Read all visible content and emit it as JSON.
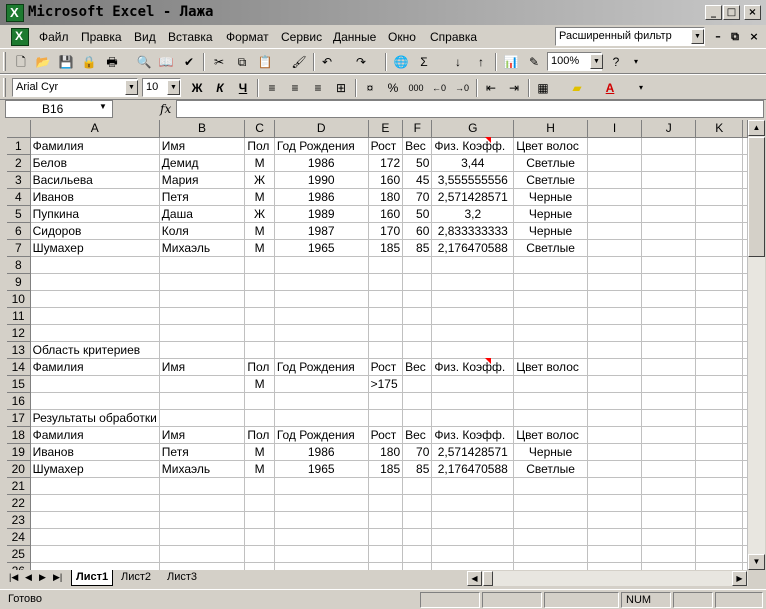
{
  "window": {
    "title": "Microsoft Excel - Лажа",
    "app_icon_letter": "X"
  },
  "menu": [
    {
      "label": "Файл"
    },
    {
      "label": "Правка"
    },
    {
      "label": "Вид"
    },
    {
      "label": "Вставка"
    },
    {
      "label": "Формат"
    },
    {
      "label": "Сервис"
    },
    {
      "label": "Данные"
    },
    {
      "label": "Окно"
    },
    {
      "label": "Справка"
    }
  ],
  "help_box": {
    "value": "Расширенный фильтр"
  },
  "toolbar": {
    "zoom": "100%"
  },
  "format_toolbar": {
    "font_name": "Arial Cyr",
    "font_size": "10",
    "bold": "Ж",
    "italic": "К",
    "underline": "Ч",
    "percent": "%",
    "thousands": "000"
  },
  "formula_bar": {
    "name_box": "B16",
    "fx": "fx",
    "formula": ""
  },
  "columns": [
    "A",
    "B",
    "C",
    "D",
    "E",
    "F",
    "G",
    "H",
    "I",
    "J",
    "K"
  ],
  "rows": [
    {
      "n": "1",
      "cells": [
        "Фамилия",
        "Имя",
        "Пол",
        "Год Рождения",
        "Рост",
        "Вес",
        "Физ. Коэфф.",
        "Цвет волос"
      ]
    },
    {
      "n": "2",
      "cells": [
        "Белов",
        "Демид",
        "М",
        "1986",
        "172",
        "50",
        "3,44",
        "Светлые"
      ]
    },
    {
      "n": "3",
      "cells": [
        "Васильева",
        "Мария",
        "Ж",
        "1990",
        "160",
        "45",
        "3,555555556",
        "Светлые"
      ]
    },
    {
      "n": "4",
      "cells": [
        "Иванов",
        "Петя",
        "М",
        "1986",
        "180",
        "70",
        "2,571428571",
        "Черные"
      ]
    },
    {
      "n": "5",
      "cells": [
        "Пупкина",
        "Даша",
        "Ж",
        "1989",
        "160",
        "50",
        "3,2",
        "Черные"
      ]
    },
    {
      "n": "6",
      "cells": [
        "Сидоров",
        "Коля",
        "М",
        "1987",
        "170",
        "60",
        "2,833333333",
        "Черные"
      ]
    },
    {
      "n": "7",
      "cells": [
        "Шумахер",
        "Михаэль",
        "М",
        "1965",
        "185",
        "85",
        "2,176470588",
        "Светлые"
      ]
    },
    {
      "n": "8",
      "cells": [
        "",
        "",
        "",
        "",
        "",
        "",
        "",
        ""
      ]
    },
    {
      "n": "9",
      "cells": [
        "",
        "",
        "",
        "",
        "",
        "",
        "",
        ""
      ]
    },
    {
      "n": "10",
      "cells": [
        "",
        "",
        "",
        "",
        "",
        "",
        "",
        ""
      ]
    },
    {
      "n": "11",
      "cells": [
        "",
        "",
        "",
        "",
        "",
        "",
        "",
        ""
      ]
    },
    {
      "n": "12",
      "cells": [
        "",
        "",
        "",
        "",
        "",
        "",
        "",
        ""
      ]
    },
    {
      "n": "13",
      "cells": [
        "Область критериев",
        "",
        "",
        "",
        "",
        "",
        "",
        ""
      ]
    },
    {
      "n": "14",
      "cells": [
        "Фамилия",
        "Имя",
        "Пол",
        "Год Рождения",
        "Рост",
        "Вес",
        "Физ. Коэфф.",
        "Цвет волос"
      ]
    },
    {
      "n": "15",
      "cells": [
        "",
        "",
        "М",
        "",
        ">175",
        "",
        "",
        ""
      ]
    },
    {
      "n": "16",
      "cells": [
        "",
        "",
        "",
        "",
        "",
        "",
        "",
        ""
      ]
    },
    {
      "n": "17",
      "cells": [
        "Результаты обработки",
        "",
        "",
        "",
        "",
        "",
        "",
        ""
      ]
    },
    {
      "n": "18",
      "cells": [
        "Фамилия",
        "Имя",
        "Пол",
        "Год Рождения",
        "Рост",
        "Вес",
        "Физ. Коэфф.",
        "Цвет волос"
      ]
    },
    {
      "n": "19",
      "cells": [
        "Иванов",
        "Петя",
        "М",
        "1986",
        "180",
        "70",
        "2,571428571",
        "Черные"
      ]
    },
    {
      "n": "20",
      "cells": [
        "Шумахер",
        "Михаэль",
        "М",
        "1965",
        "185",
        "85",
        "2,176470588",
        "Светлые"
      ]
    },
    {
      "n": "21",
      "cells": [
        "",
        "",
        "",
        "",
        "",
        "",
        "",
        ""
      ]
    },
    {
      "n": "22",
      "cells": [
        "",
        "",
        "",
        "",
        "",
        "",
        "",
        ""
      ]
    },
    {
      "n": "23",
      "cells": [
        "",
        "",
        "",
        "",
        "",
        "",
        "",
        ""
      ]
    },
    {
      "n": "24",
      "cells": [
        "",
        "",
        "",
        "",
        "",
        "",
        "",
        ""
      ]
    },
    {
      "n": "25",
      "cells": [
        "",
        "",
        "",
        "",
        "",
        "",
        "",
        ""
      ]
    },
    {
      "n": "26",
      "cells": [
        "",
        "",
        "",
        "",
        "",
        "",
        "",
        ""
      ]
    }
  ],
  "sheets": [
    {
      "label": "Лист1",
      "active": true
    },
    {
      "label": "Лист2"
    },
    {
      "label": "Лист3"
    }
  ],
  "status": {
    "text": "Готово",
    "num": "NUM"
  },
  "colors": {
    "comment_marker": "#ff0000",
    "excel_green": "#1d7a30"
  }
}
